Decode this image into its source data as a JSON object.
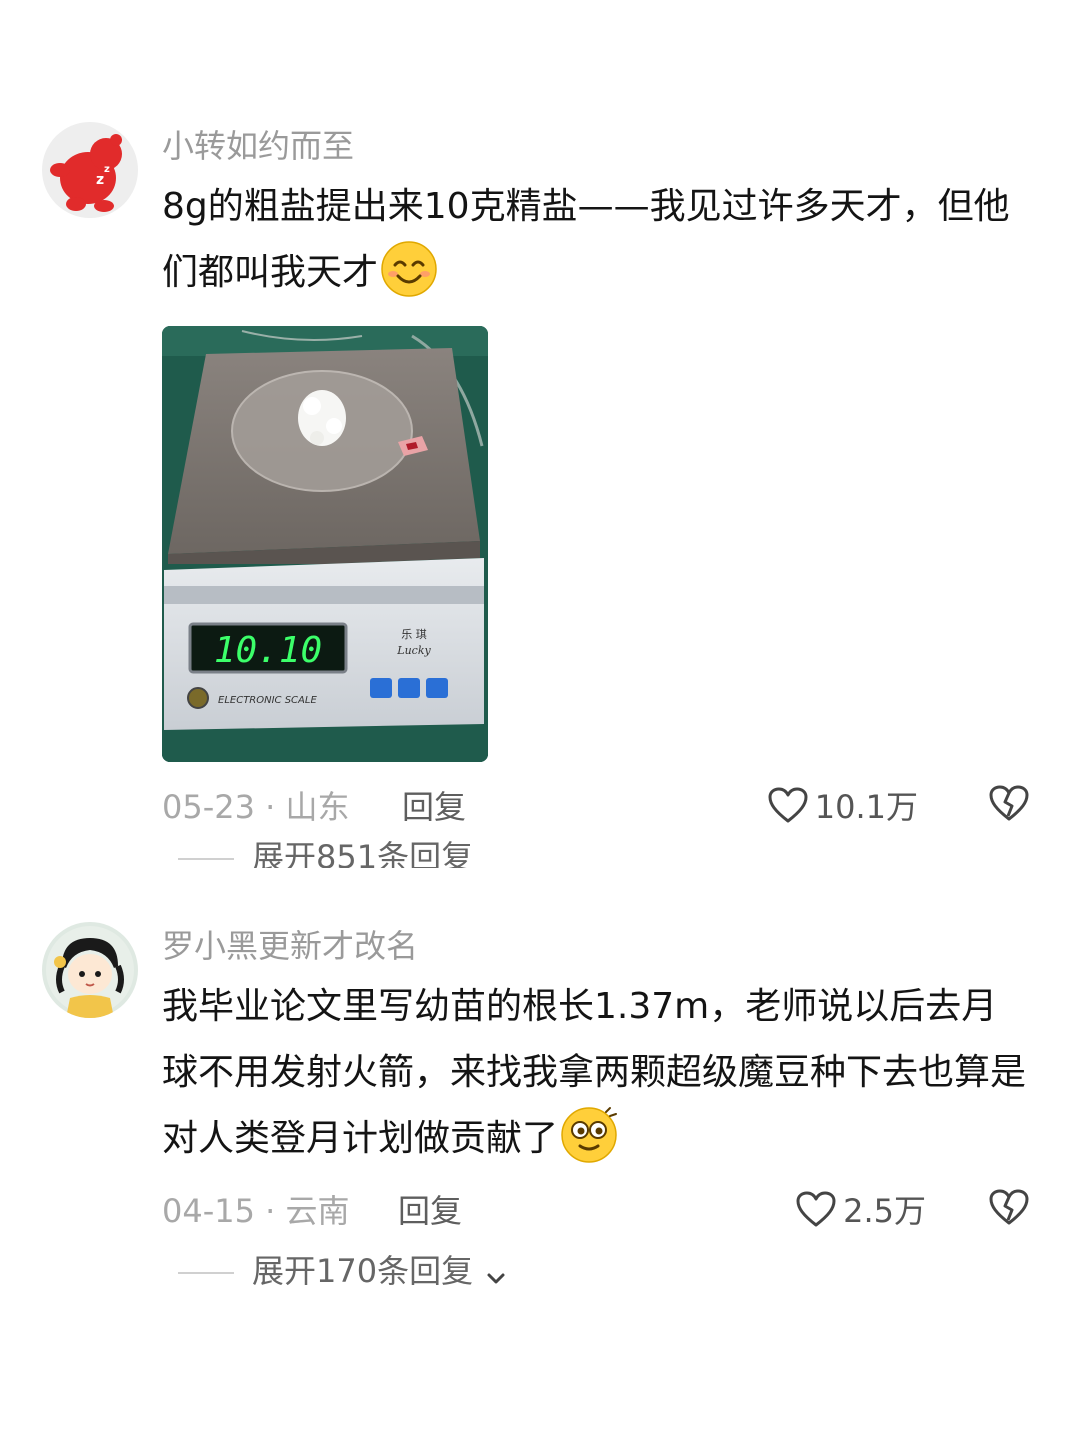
{
  "comments": [
    {
      "username": "小转如约而至",
      "text": "8g的粗盐提出来10克精盐——我见过许多天才，但他们都叫我天才",
      "emoji_icon": "smiling-face-icon",
      "image": {
        "scale_reading": "10.10",
        "brand_text": "Lucky",
        "scale_label": "ELECTRONIC SCALE"
      },
      "date_location": "05-23 · 山东",
      "reply_label": "回复",
      "likes": "10.1万",
      "expand_label": "展开851条回复"
    },
    {
      "username": "罗小黑更新才改名",
      "text": "我毕业论文里写幼苗的根长1.37m，老师说以后去月球不用发射火箭，来找我拿两颗超级魔豆种下去也算是对人类登月计划做贡献了",
      "emoji_icon": "dizzy-face-icon",
      "date_location": "04-15 · 云南",
      "reply_label": "回复",
      "likes": "2.5万",
      "expand_label": "展开170条回复"
    }
  ],
  "colors": {
    "username": "#9a9a9a",
    "text": "#141414",
    "meta": "#a8a8a8",
    "scale_display": "#3cff6a"
  }
}
